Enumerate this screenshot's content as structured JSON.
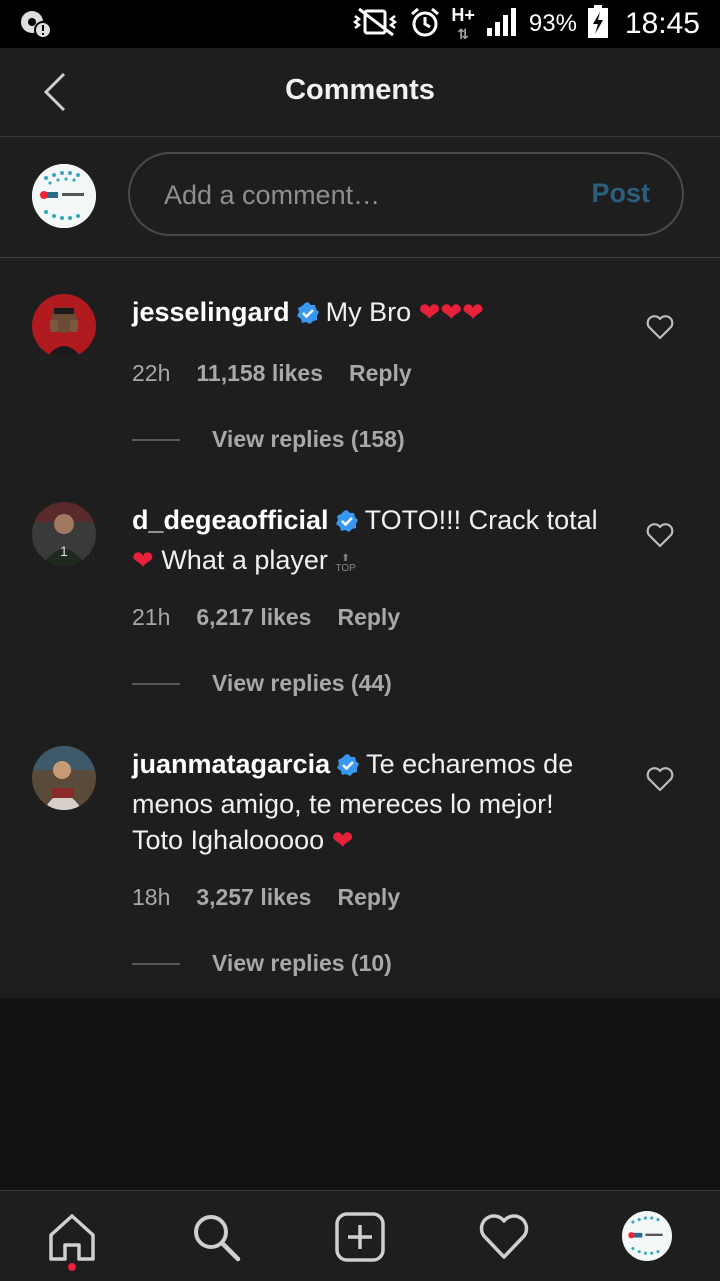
{
  "status_bar": {
    "battery_percent": "93%",
    "time": "18:45",
    "network": "H+"
  },
  "header": {
    "title": "Comments"
  },
  "composer": {
    "placeholder": "Add a comment…",
    "post_label": "Post"
  },
  "comments": [
    {
      "username": "jesselingard",
      "verified": true,
      "text_lines": [
        "My Bro"
      ],
      "hearts": "❤❤❤",
      "age": "22h",
      "likes": "11,158 likes",
      "reply_label": "Reply",
      "view_replies": "View replies (158)"
    },
    {
      "username": "d_degeaofficial",
      "verified": true,
      "text_line1": "TOTO!!! Crack total",
      "heart": "❤",
      "text_line2": "What a player",
      "age": "21h",
      "likes": "6,217 likes",
      "reply_label": "Reply",
      "view_replies": "View replies (44)"
    },
    {
      "username": "juanmatagarcia",
      "verified": true,
      "text_line1": "Te echaremos de",
      "text_line2": "menos amigo, te mereces lo mejor!",
      "text_line3": "Toto Ighalooooo",
      "heart": "❤",
      "age": "18h",
      "likes": "3,257 likes",
      "reply_label": "Reply",
      "view_replies": "View replies (10)"
    }
  ],
  "tab_bar": {
    "items": [
      "home-icon",
      "search-icon",
      "new-post-icon",
      "activity-heart-icon",
      "profile-avatar"
    ],
    "active": "home-icon"
  },
  "colors": {
    "background": "#121212",
    "panel": "#1e1e1e",
    "post_button": "#2a5f7d",
    "verified_badge": "#3897f0",
    "heart": "#e8203a"
  }
}
